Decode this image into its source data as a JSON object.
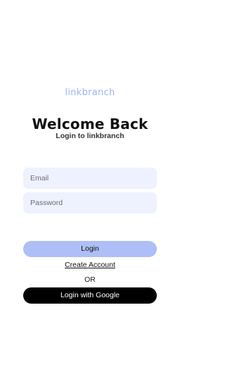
{
  "brand": {
    "logo_text": "linkbranch",
    "logo_color": "#9fb3f3"
  },
  "header": {
    "title": "Welcome Back",
    "subtitle": "Login to linkbranch"
  },
  "form": {
    "email": {
      "placeholder": "Email",
      "value": ""
    },
    "password": {
      "placeholder": "Password",
      "value": ""
    },
    "field_background": "#eef2ff"
  },
  "actions": {
    "login_label": "Login",
    "login_color": "#aebef7",
    "create_account_label": "Create Account",
    "or_label": "OR",
    "google_label": "Login with Google",
    "google_color": "#000000"
  }
}
